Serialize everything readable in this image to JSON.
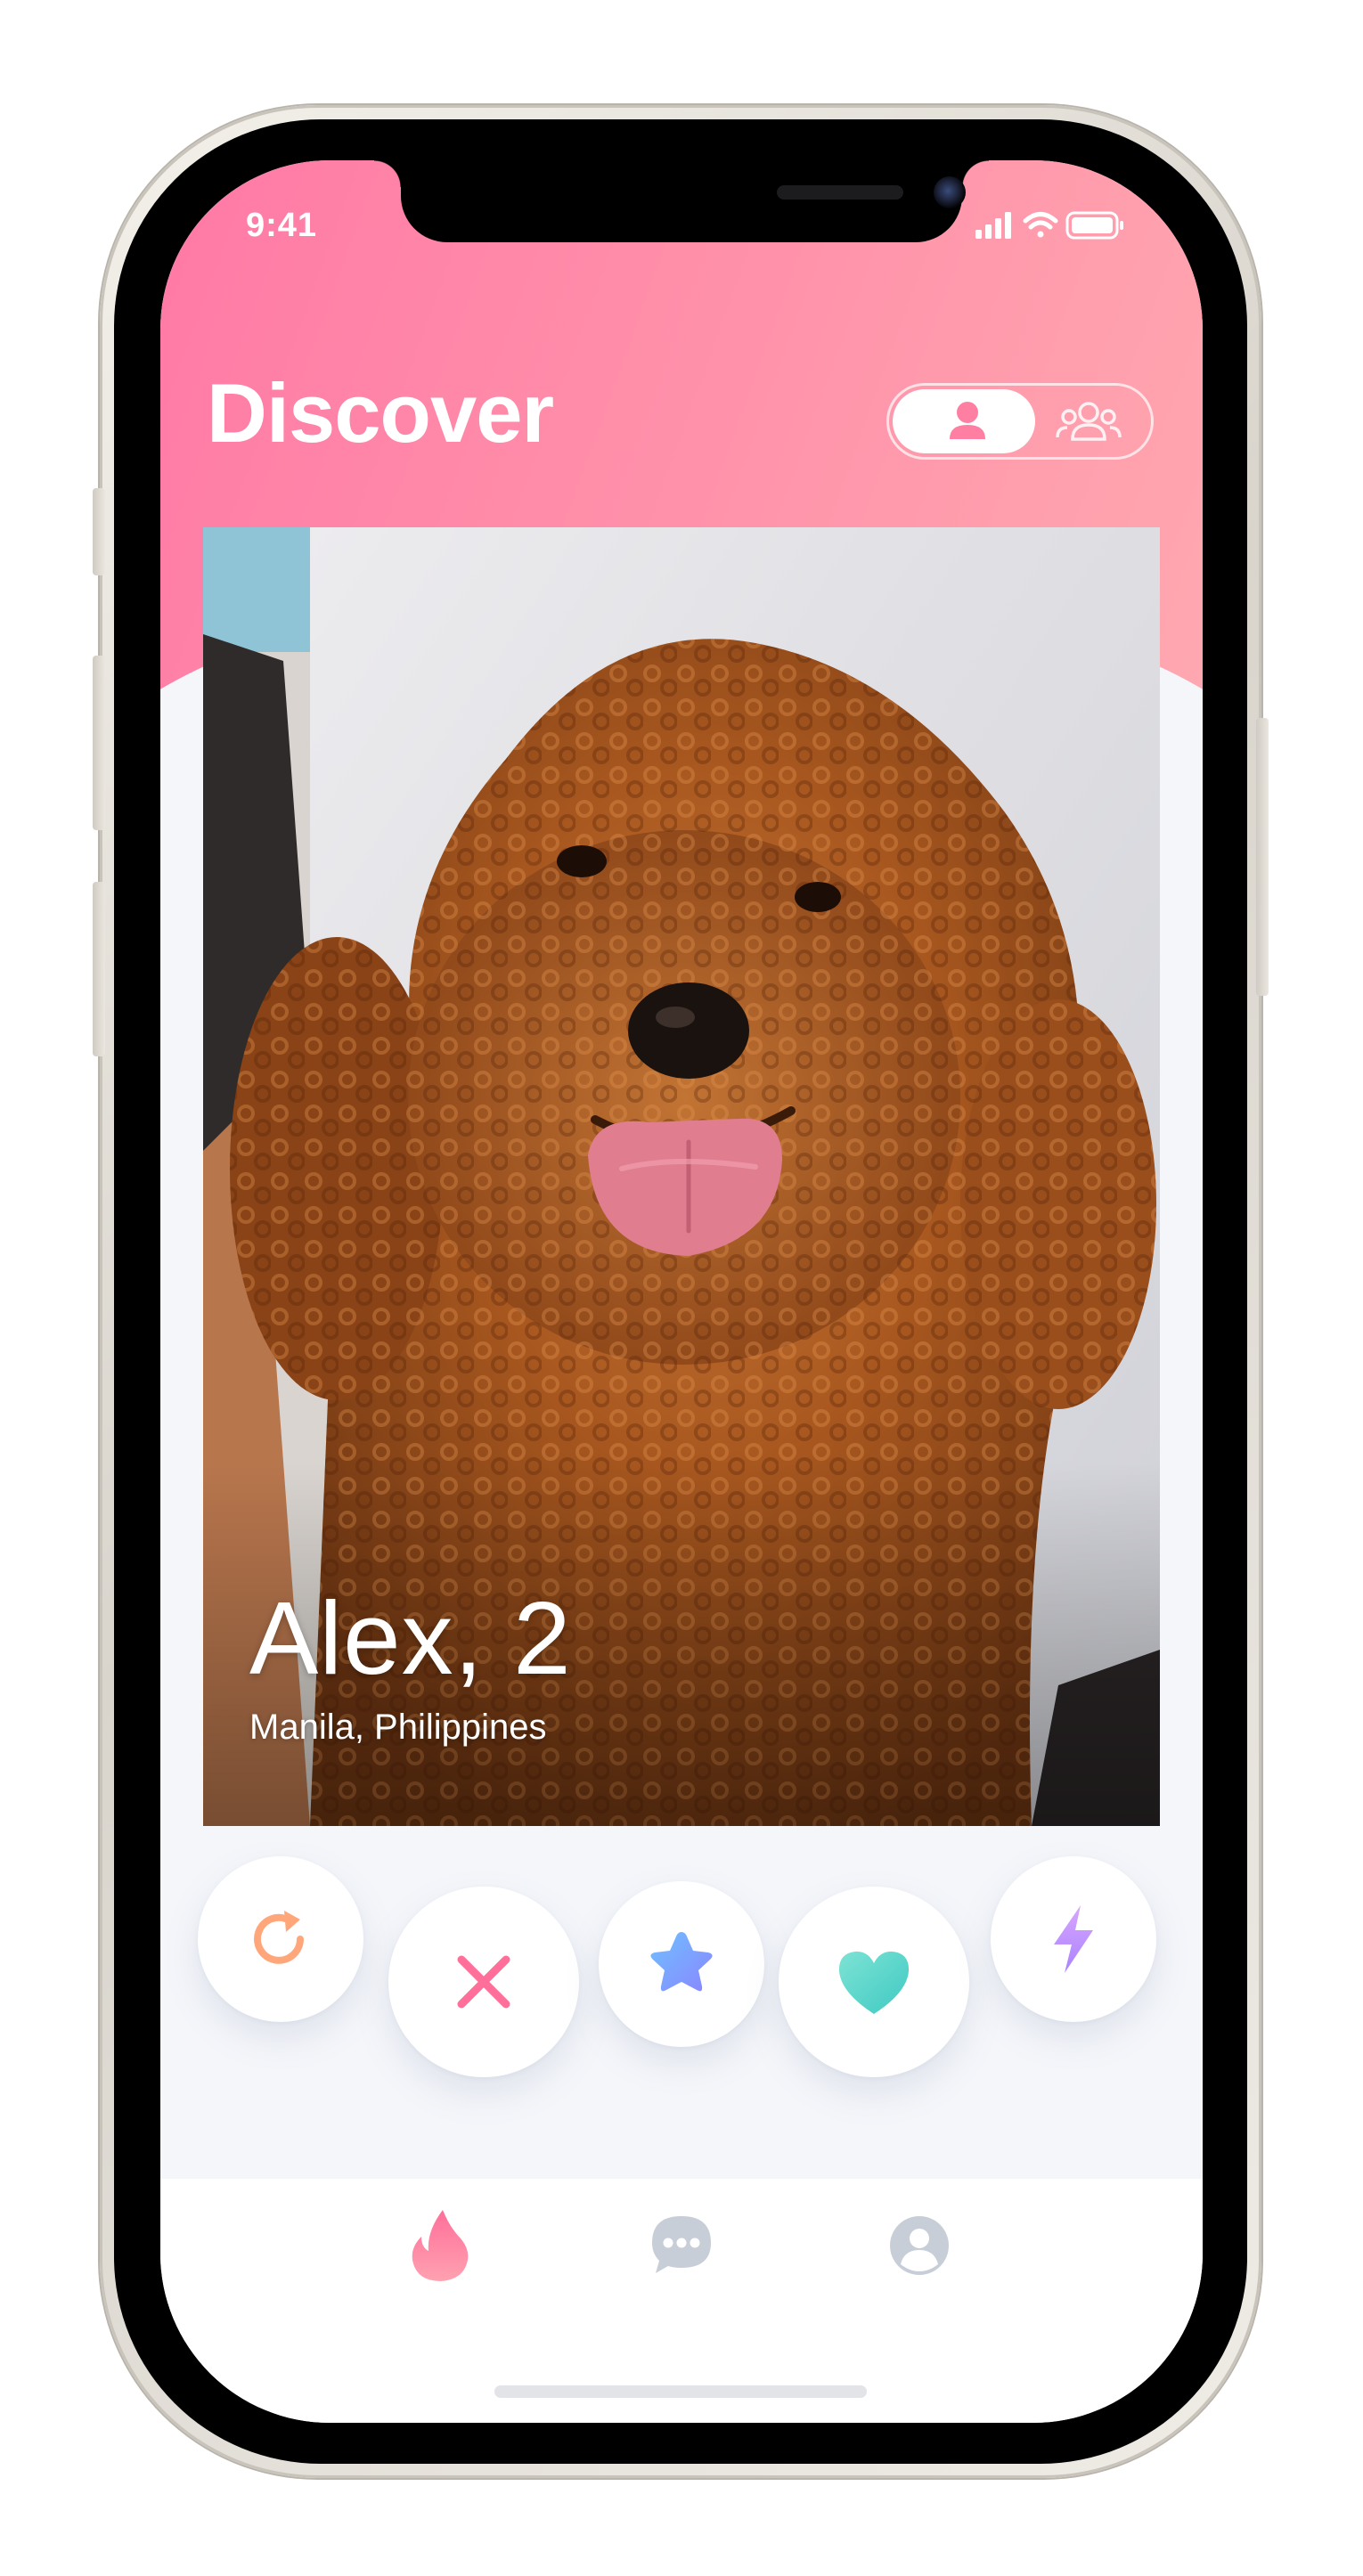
{
  "status_bar": {
    "time": "9:41"
  },
  "header": {
    "title": "Discover",
    "mode_toggle": {
      "options": [
        "single-user-icon",
        "group-users-icon"
      ],
      "selected": "single-user-icon"
    }
  },
  "card": {
    "name_age": "Alex, 2",
    "location": "Manila, Philippines"
  },
  "actions": [
    {
      "name": "rewind",
      "icon": "rewind-icon",
      "color": "#ffa77a"
    },
    {
      "name": "nope",
      "icon": "close-icon",
      "color": "#ff6f9a"
    },
    {
      "name": "super-like",
      "icon": "star-icon",
      "color": "#7aa6ff"
    },
    {
      "name": "like",
      "icon": "heart-icon",
      "color": "#5fd9cf"
    },
    {
      "name": "boost",
      "icon": "lightning-icon",
      "color": "#c79bff"
    }
  ],
  "tab_bar": {
    "tabs": [
      "flame-icon",
      "chat-icon",
      "profile-icon"
    ],
    "active": "flame-icon",
    "active_color": "#ff7fa3",
    "inactive_color": "#c8ced8"
  },
  "colors": {
    "header_gradient_start": "#ff79a6",
    "header_gradient_end": "#ffa8b0",
    "background": "#f4f6fa"
  }
}
